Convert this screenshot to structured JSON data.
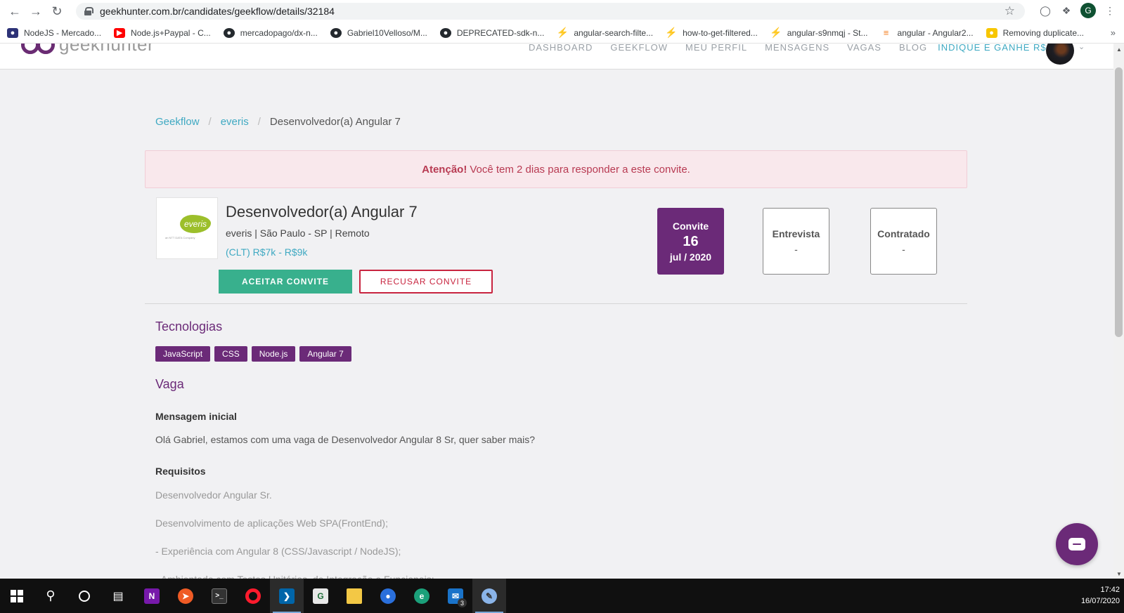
{
  "browser": {
    "url": "geekhunter.com.br/candidates/geekflow/details/32184",
    "profile_initial": "G",
    "bookmarks": [
      {
        "label": "NodeJS - Mercado...",
        "icon": "mercadolibre-icon",
        "color": "#2d3277"
      },
      {
        "label": "Node.js+Paypal - C...",
        "icon": "youtube-icon",
        "color": "#ff0000"
      },
      {
        "label": "mercadopago/dx-n...",
        "icon": "github-icon",
        "color": "#24292e"
      },
      {
        "label": "Gabriel10Velloso/M...",
        "icon": "github-icon",
        "color": "#24292e"
      },
      {
        "label": "DEPRECATED-sdk-n...",
        "icon": "github-icon",
        "color": "#24292e"
      },
      {
        "label": "angular-search-filte...",
        "icon": "stackblitz-icon",
        "color": "#1389fd"
      },
      {
        "label": "how-to-get-filtered...",
        "icon": "stackblitz-icon",
        "color": "#1389fd"
      },
      {
        "label": "angular-s9nmqj - St...",
        "icon": "stackblitz-icon",
        "color": "#1389fd"
      },
      {
        "label": "angular - Angular2...",
        "icon": "stackoverflow-icon",
        "color": "#f48024"
      },
      {
        "label": "Removing duplicate...",
        "icon": "bookmark-yellow-icon",
        "color": "#f7c600"
      }
    ]
  },
  "header": {
    "logo_text": "geekhunter",
    "nav": [
      "DASHBOARD",
      "GEEKFLOW",
      "MEU PERFIL",
      "MENSAGENS",
      "VAGAS",
      "BLOG"
    ],
    "refer": "INDIQUE E GANHE R$ 500"
  },
  "breadcrumb": {
    "items": [
      "Geekflow",
      "everis"
    ],
    "current": "Desenvolvedor(a) Angular 7"
  },
  "alert": {
    "strong": "Atenção!",
    "text": "Você tem 2 dias para responder a este convite."
  },
  "job": {
    "company_logo_text": "everis",
    "company_logo_sub": "an NTT DATA Company",
    "title": "Desenvolvedor(a) Angular 7",
    "meta": "everis | São Paulo - SP | Remoto",
    "salary": "(CLT) R$7k - R$9k",
    "accept_label": "ACEITAR CONVITE",
    "refuse_label": "RECUSAR CONVITE"
  },
  "stages": [
    {
      "label": "Convite",
      "day": "16",
      "date": "jul / 2020",
      "active": true
    },
    {
      "label": "Entrevista",
      "value": "-",
      "active": false
    },
    {
      "label": "Contratado",
      "value": "-",
      "active": false
    }
  ],
  "technologies": {
    "title": "Tecnologias",
    "tags": [
      "JavaScript",
      "CSS",
      "Node.js",
      "Angular 7"
    ]
  },
  "vaga": {
    "title": "Vaga",
    "initial_message_title": "Mensagem inicial",
    "initial_message": "Olá Gabriel, estamos com uma vaga de Desenvolvedor Angular 8 Sr, quer saber mais?",
    "requirements_title": "Requisitos",
    "requirements": [
      "Desenvolvedor Angular Sr.",
      "Desenvolvimento de aplicações Web SPA(FrontEnd);",
      "- Experiência com Angular 8 (CSS/Javascript / NodeJS);",
      "- Ambientado com Testes Unitários, de Integração e Funcionais;"
    ]
  },
  "taskbar": {
    "time": "17:42",
    "date": "16/07/2020",
    "mail_badge": "3"
  }
}
